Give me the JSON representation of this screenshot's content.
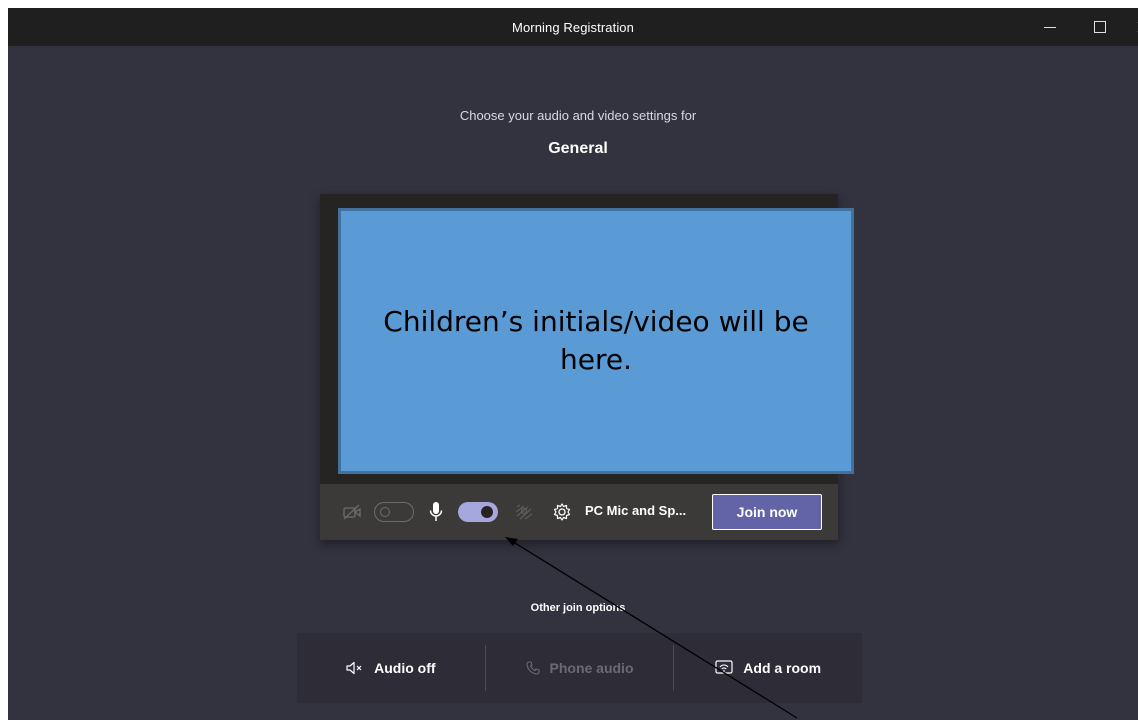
{
  "window": {
    "title": "Morning Registration",
    "minimize_icon": "minimize-icon",
    "maximize_icon": "maximize-icon",
    "close_icon": "close-icon"
  },
  "prejoin": {
    "subtitle": "Choose your audio and video settings for",
    "channel": "General"
  },
  "preview": {
    "placeholder_text": "Children’s initials/video will be here.",
    "placeholder_bg": "#5b9bd5"
  },
  "controls": {
    "camera_icon": "camera-off-icon",
    "camera_on": false,
    "mic_icon": "microphone-icon",
    "mic_on": true,
    "blur_icon": "background-blur-icon",
    "settings_icon": "gear-icon",
    "device_label": "PC Mic and Sp...",
    "join_label": "Join now",
    "accent": "#6264a7",
    "toggle_on_color": "#a6a7dc"
  },
  "other_options": {
    "heading": "Other join options",
    "items": [
      {
        "label": "Audio off",
        "icon": "speaker-mute-icon",
        "enabled": true
      },
      {
        "label": "Phone audio",
        "icon": "phone-icon",
        "enabled": false
      },
      {
        "label": "Add a room",
        "icon": "room-cast-icon",
        "enabled": true
      }
    ]
  }
}
